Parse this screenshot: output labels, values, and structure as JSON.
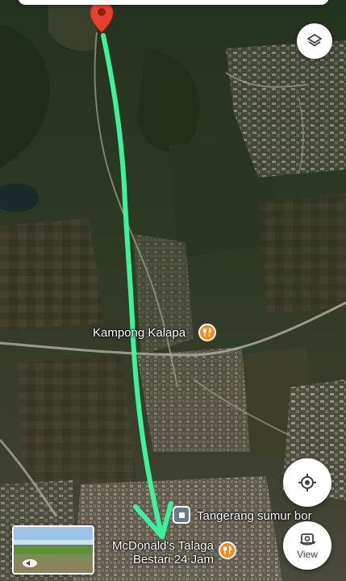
{
  "map": {
    "type": "satellite",
    "route_color": "#3df29a",
    "pin_color": "#e8402f",
    "poi_food_color": "#f28b1b"
  },
  "pois": {
    "kampong": {
      "name": "Kampong Kalapa",
      "icon": "fork-knife-icon"
    },
    "tangerang": {
      "name": "Tangerang sumur bor",
      "icon": "square-place-icon"
    },
    "mcd": {
      "line1": "McDonald's Talaga",
      "line2": "Bestari 24 Jam",
      "icon": "fork-knife-icon"
    }
  },
  "controls": {
    "layers_icon": "layers-icon",
    "locate_icon": "my-location-icon",
    "view_label": "View",
    "view_icon": "360-camera-icon"
  }
}
